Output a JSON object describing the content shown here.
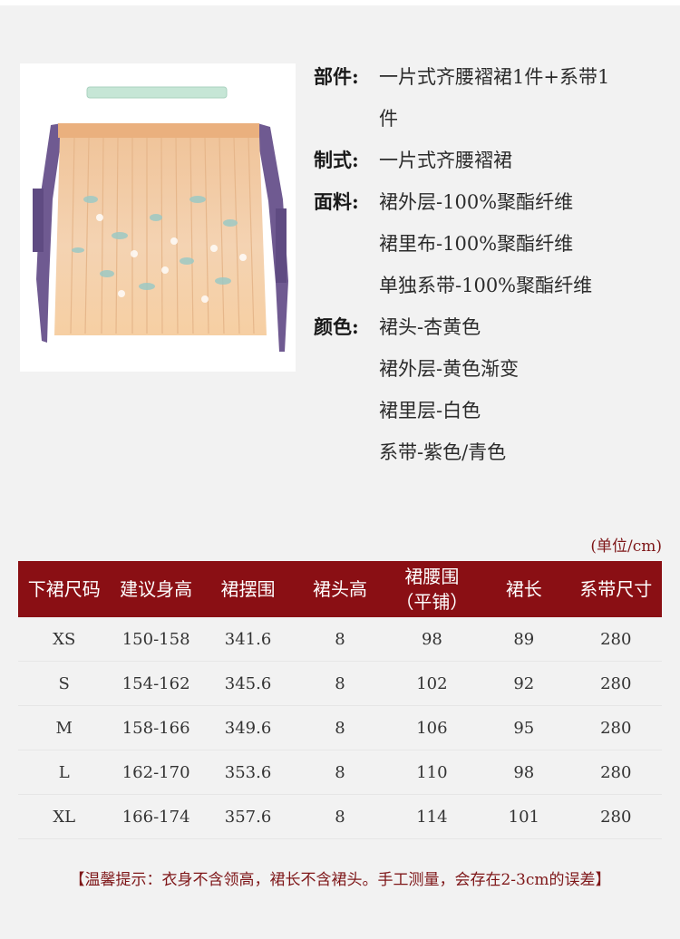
{
  "specs": [
    {
      "key": "部件:",
      "values": [
        "一片式齐腰褶裙1件+系带1",
        "件"
      ]
    },
    {
      "key": "制式:",
      "values": [
        "一片式齐腰褶裙"
      ]
    },
    {
      "key": "面料:",
      "values": [
        "裙外层-100%聚酯纤维",
        "裙里布-100%聚酯纤维",
        "单独系带-100%聚酯纤维"
      ]
    },
    {
      "key": "颜色:",
      "values": [
        "裙头-杏黄色",
        "裙外层-黄色渐变",
        "裙里层-白色",
        "系带-紫色/青色"
      ]
    }
  ],
  "unit_note": "(单位/cm)",
  "table": {
    "headers": [
      "下裙尺码",
      "建议身高",
      "裙摆围",
      "裙头高",
      "裙腰围",
      "（平铺）",
      "裙长",
      "系带尺寸"
    ],
    "rows": [
      [
        "XS",
        "150-158",
        "341.6",
        "8",
        "98",
        "89",
        "280"
      ],
      [
        "S",
        "154-162",
        "345.6",
        "8",
        "102",
        "92",
        "280"
      ],
      [
        "M",
        "158-166",
        "349.6",
        "8",
        "106",
        "95",
        "280"
      ],
      [
        "L",
        "162-170",
        "353.6",
        "8",
        "110",
        "98",
        "280"
      ],
      [
        "XL",
        "166-174",
        "357.6",
        "8",
        "114",
        "101",
        "280"
      ]
    ]
  },
  "tip": "【温馨提示：衣身不含领高，裙长不含裙头。手工测量，会存在2-3cm的误差】",
  "colors": {
    "accent_red": "#8a0f14",
    "skirt_waistband": "#eab07e",
    "skirt_body": "#f2c9a0",
    "tie_purple": "#6f5a91",
    "tie_mint": "#c6e6d6"
  }
}
